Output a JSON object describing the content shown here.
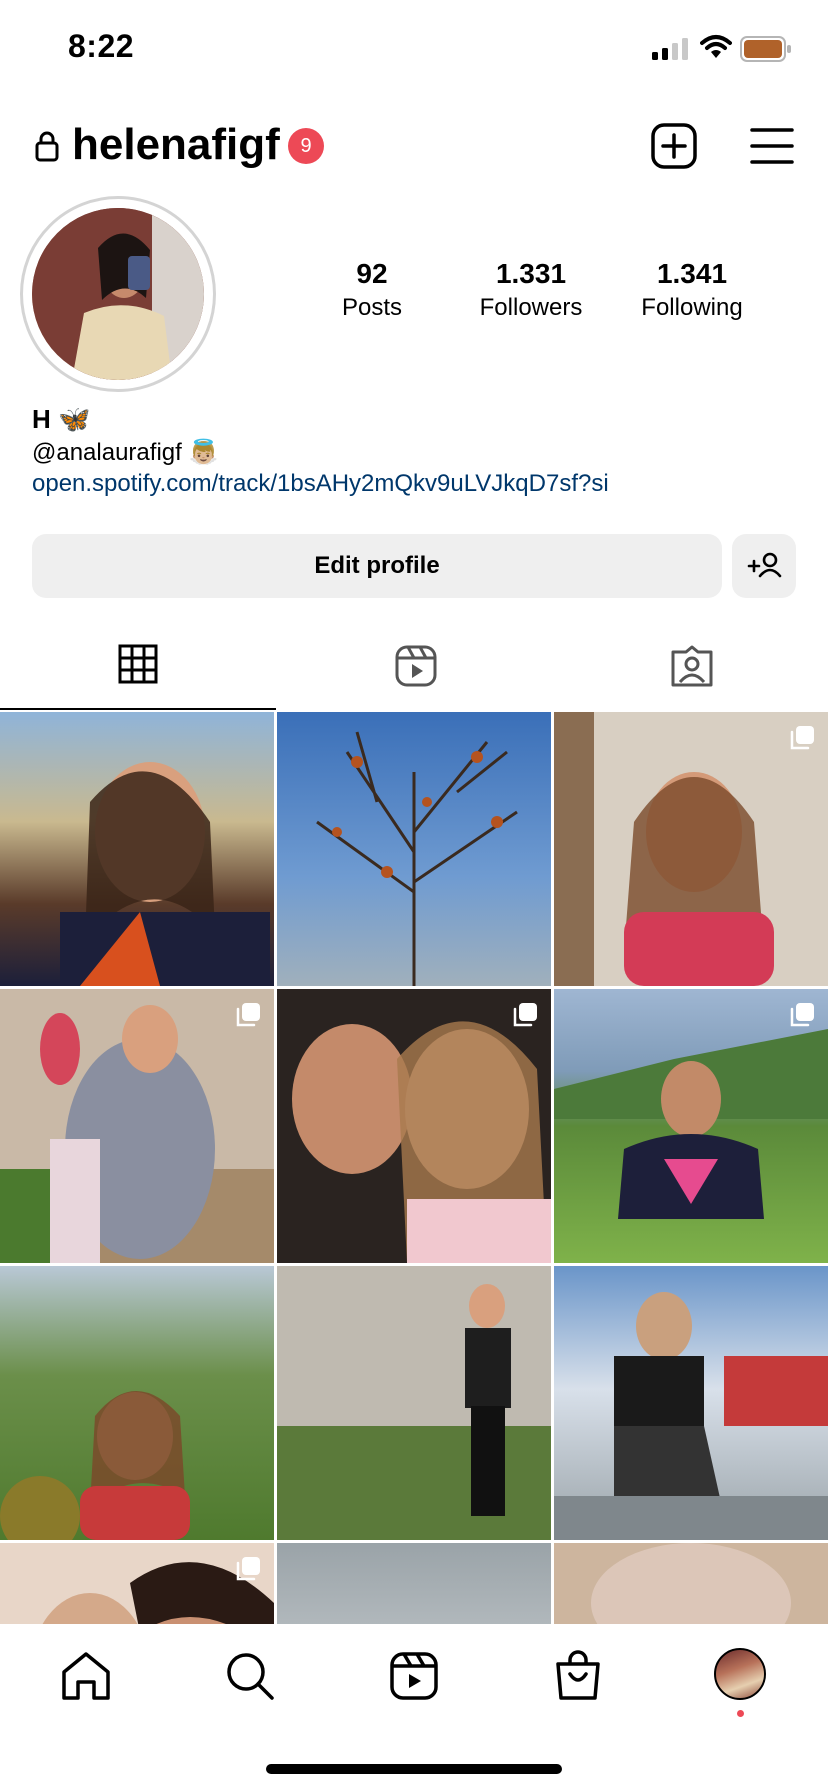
{
  "status_bar": {
    "time": "8:22"
  },
  "header": {
    "username": "helenafigf",
    "notification_count": "9"
  },
  "profile": {
    "stats": [
      {
        "value": "92",
        "label": "Posts"
      },
      {
        "value": "1.331",
        "label": "Followers"
      },
      {
        "value": "1.341",
        "label": "Following"
      }
    ],
    "bio_name": "H 🦋",
    "bio_mention": "@analaurafigf 👼🏼",
    "bio_link": "open.spotify.com/track/1bsAHy2mQkv9uLVJkqD7sf?si"
  },
  "actions": {
    "edit_profile": "Edit profile"
  },
  "tabs": [
    "grid-icon",
    "reels-icon",
    "tagged-icon"
  ],
  "colors": {
    "badge": "#ed4956",
    "link": "#00376b",
    "button_bg": "#efefef"
  },
  "bottom_nav": [
    "home-icon",
    "search-icon",
    "reels-icon",
    "shop-icon",
    "profile-avatar"
  ]
}
